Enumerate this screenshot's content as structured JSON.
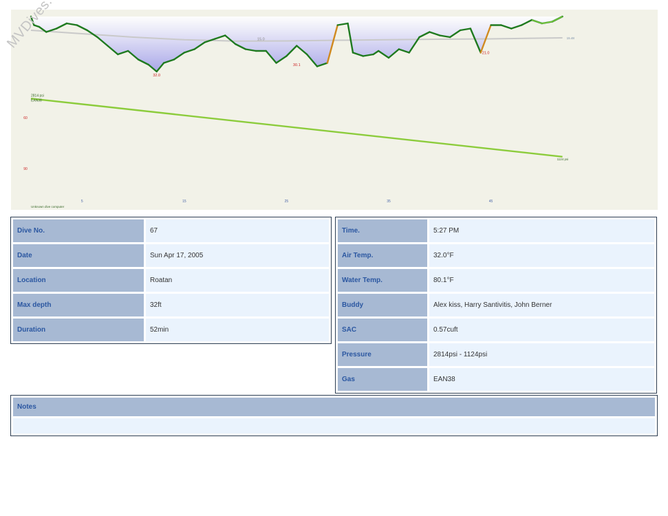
{
  "watermark": "MVDives.com",
  "chart_data": {
    "type": "line",
    "computer_label": "Unknown dive computer",
    "xlim": [
      0,
      56
    ],
    "x_ticks": [
      5,
      15,
      25,
      35,
      45
    ],
    "y_ticks": [
      60,
      90
    ],
    "depth_ylim": [
      0,
      40
    ],
    "pressure_ylim": [
      0,
      5000
    ],
    "depth_profile": {
      "time": [
        0,
        0.3,
        0.8,
        1.5,
        2.5,
        3.5,
        4.5,
        5.5,
        6.5,
        7.5,
        8.5,
        9.5,
        10.5,
        11.5,
        12.3,
        13,
        14,
        15,
        16,
        17,
        18,
        19,
        20,
        21,
        22,
        23,
        24,
        25,
        26,
        27,
        28,
        29,
        30,
        31,
        31.5,
        32.5,
        33.5,
        34,
        35,
        36,
        37,
        38,
        39,
        40,
        41,
        42,
        43,
        44,
        45,
        46,
        47,
        48,
        49,
        50,
        51,
        52
      ],
      "depth": [
        0,
        5,
        6,
        9,
        7,
        4,
        5,
        8,
        12,
        17,
        22,
        20,
        25,
        28,
        32,
        27,
        25,
        21,
        19,
        15,
        13,
        11,
        16,
        19,
        20,
        20,
        27,
        23,
        17,
        22,
        29,
        27,
        5,
        4,
        21,
        23,
        22,
        20,
        24,
        19,
        21,
        12,
        9,
        11,
        12,
        8,
        7,
        21,
        5,
        5,
        7,
        5,
        2,
        4,
        3,
        0
      ],
      "max_label": "32.0",
      "mid_labels": [
        {
          "t": 22.5,
          "d": 13,
          "text": "15.0"
        },
        {
          "t": 26,
          "d": 28,
          "text": "30.1"
        },
        {
          "t": 44.5,
          "d": 21,
          "text": "21.0"
        }
      ]
    },
    "temperature_line": {
      "time": [
        0,
        5,
        10,
        15,
        20,
        25,
        30,
        35,
        40,
        45,
        52
      ],
      "depth": [
        8,
        10,
        12,
        13.5,
        14.3,
        14.2,
        13.8,
        13.5,
        13.2,
        13,
        12.4
      ],
      "end_label": "15.48"
    },
    "pressure_line": {
      "time": [
        0,
        52
      ],
      "psi": [
        2814,
        1124
      ],
      "start_label": "2814 psi",
      "end_label": "1124 psi",
      "gas_label": "EAN38"
    },
    "colors": {
      "depth_line": "#1f7a1f",
      "depth_fill": "#a8a6e8",
      "pressure": "#8ccc3c",
      "temperature": "#c9c9c9",
      "ascent_fast": "#e03030",
      "ascent_mid": "#d08a20",
      "label_red": "#cc2222"
    }
  },
  "left_table": [
    {
      "label": "Dive No.",
      "value": "67"
    },
    {
      "label": "Date",
      "value": "Sun Apr 17, 2005"
    },
    {
      "label": "Location",
      "value": "Roatan"
    },
    {
      "label": "Max depth",
      "value": "32ft"
    },
    {
      "label": "Duration",
      "value": "52min"
    }
  ],
  "right_table": [
    {
      "label": "Time.",
      "value": "5:27 PM"
    },
    {
      "label": "Air Temp.",
      "value": "32.0°F"
    },
    {
      "label": "Water Temp.",
      "value": "80.1°F"
    },
    {
      "label": "Buddy",
      "value": "Alex kiss, Harry Santivitis, John Berner"
    },
    {
      "label": "SAC",
      "value": "0.57cuft"
    },
    {
      "label": "Pressure",
      "value": "2814psi - 1124psi"
    },
    {
      "label": "Gas",
      "value": "EAN38"
    }
  ],
  "notes": {
    "label": "Notes",
    "value": ""
  }
}
